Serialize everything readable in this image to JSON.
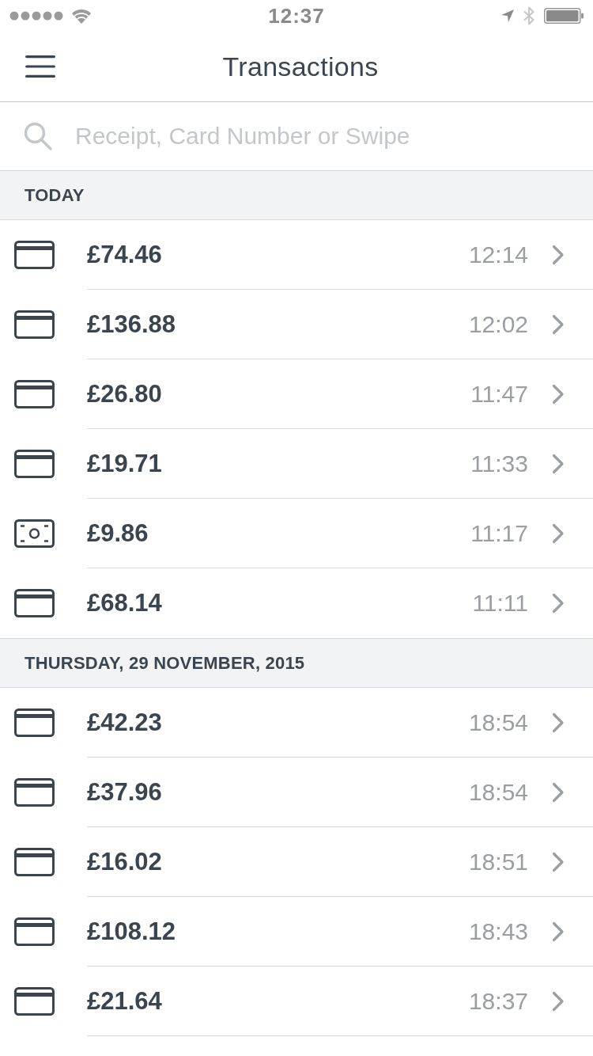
{
  "status_bar": {
    "time": "12:37"
  },
  "nav": {
    "title": "Transactions"
  },
  "search": {
    "placeholder": "Receipt, Card Number or Swipe"
  },
  "sections": [
    {
      "heading": "TODAY",
      "transactions": [
        {
          "kind": "card",
          "amount": "£74.46",
          "time": "12:14"
        },
        {
          "kind": "card",
          "amount": "£136.88",
          "time": "12:02"
        },
        {
          "kind": "card",
          "amount": "£26.80",
          "time": "11:47"
        },
        {
          "kind": "card",
          "amount": "£19.71",
          "time": "11:33"
        },
        {
          "kind": "cash",
          "amount": "£9.86",
          "time": "11:17"
        },
        {
          "kind": "card",
          "amount": "£68.14",
          "time": "11:11"
        }
      ]
    },
    {
      "heading": "THURSDAY, 29 NOVEMBER, 2015",
      "transactions": [
        {
          "kind": "card",
          "amount": "£42.23",
          "time": "18:54"
        },
        {
          "kind": "card",
          "amount": "£37.96",
          "time": "18:54"
        },
        {
          "kind": "card",
          "amount": "£16.02",
          "time": "18:51"
        },
        {
          "kind": "card",
          "amount": "£108.12",
          "time": "18:43"
        },
        {
          "kind": "card",
          "amount": "£21.64",
          "time": "18:37"
        }
      ]
    }
  ]
}
